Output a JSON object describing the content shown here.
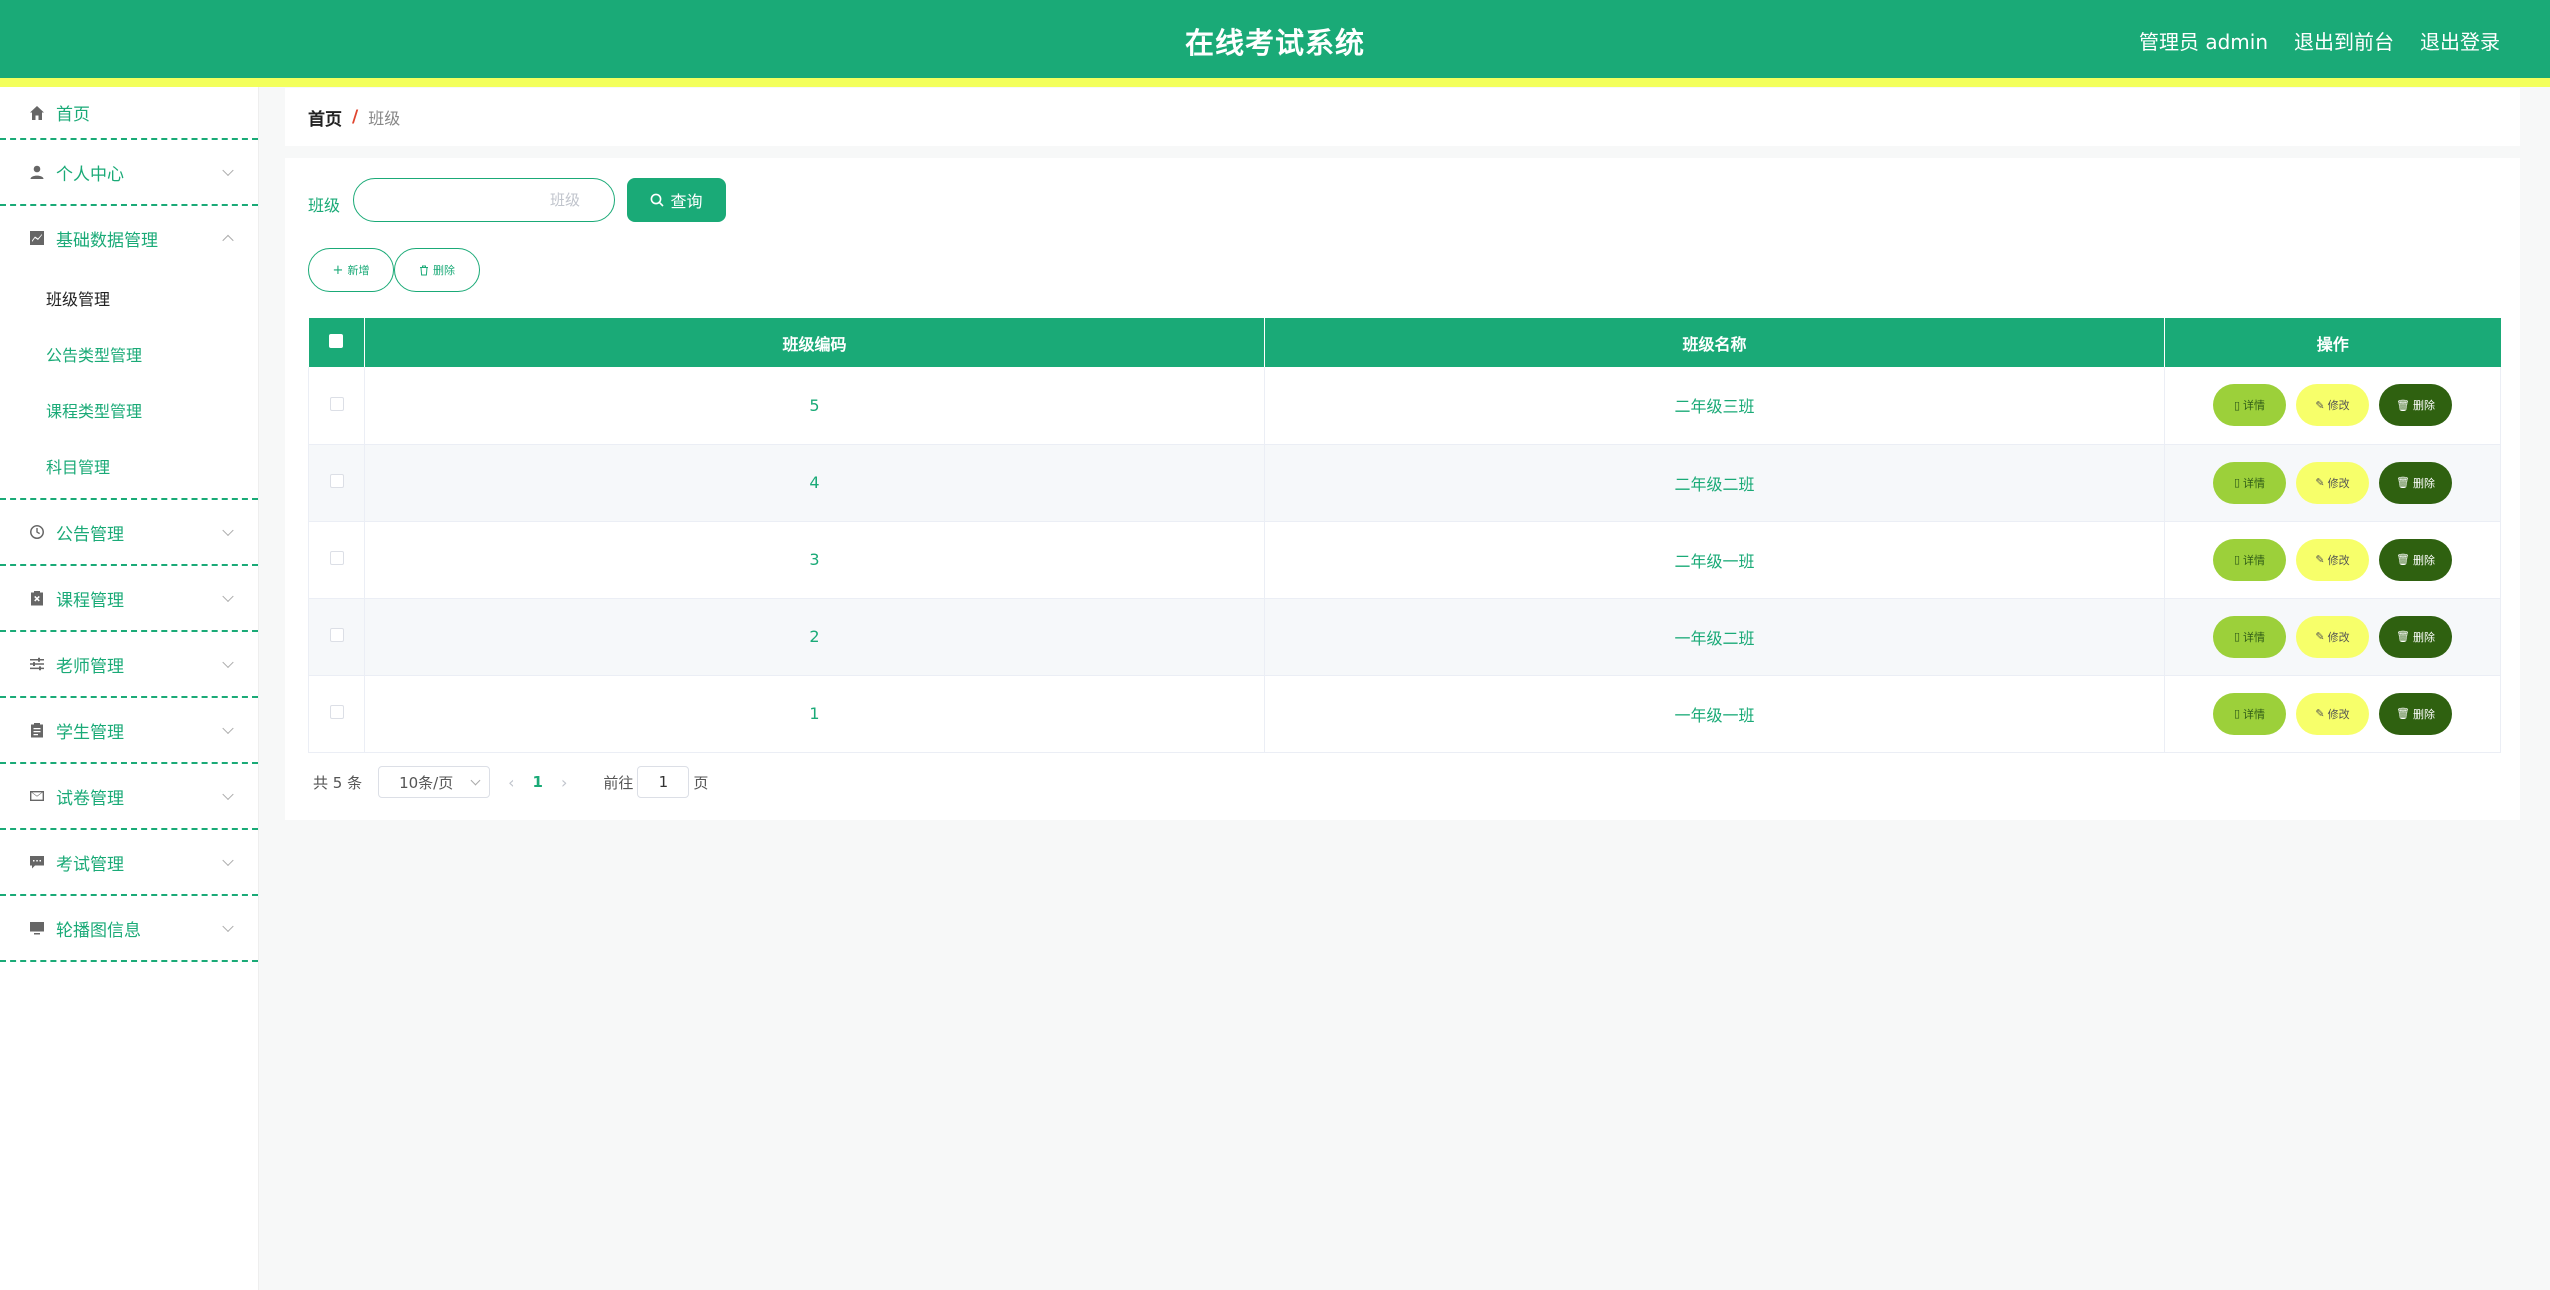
{
  "header": {
    "title": "在线考试系统",
    "admin_label": "管理员 admin",
    "front_link": "退出到前台",
    "logout_link": "退出登录"
  },
  "sidebar": {
    "home": "首页",
    "items": [
      {
        "label": "个人中心",
        "icon": "user-icon"
      },
      {
        "label": "基础数据管理",
        "icon": "chart-icon",
        "expanded": true,
        "children": [
          "班级管理",
          "公告类型管理",
          "课程类型管理",
          "科目管理"
        ],
        "active_child": "班级管理"
      },
      {
        "label": "公告管理",
        "icon": "clock-icon"
      },
      {
        "label": "课程管理",
        "icon": "clipboard-x-icon"
      },
      {
        "label": "老师管理",
        "icon": "sliders-icon"
      },
      {
        "label": "学生管理",
        "icon": "clipboard-icon"
      },
      {
        "label": "试卷管理",
        "icon": "mail-icon"
      },
      {
        "label": "考试管理",
        "icon": "chat-icon"
      },
      {
        "label": "轮播图信息",
        "icon": "monitor-icon"
      }
    ]
  },
  "breadcrumb": {
    "home": "首页",
    "separator": "/",
    "current": "班级"
  },
  "search": {
    "label": "班级",
    "placeholder": "班级",
    "value": "",
    "button": "查询"
  },
  "actions": {
    "add": "新增",
    "delete": "删除"
  },
  "table": {
    "columns": [
      "班级编码",
      "班级名称",
      "操作"
    ],
    "rows": [
      {
        "code": "5",
        "name": "二年级三班"
      },
      {
        "code": "4",
        "name": "二年级二班"
      },
      {
        "code": "3",
        "name": "二年级一班"
      },
      {
        "code": "2",
        "name": "一年级二班"
      },
      {
        "code": "1",
        "name": "一年级一班"
      }
    ],
    "row_actions": {
      "detail": "详情",
      "edit": "修改",
      "delete": "删除"
    }
  },
  "pagination": {
    "total_text": "共 5 条",
    "page_size": "10条/页",
    "current_page": "1",
    "goto_label": "前往",
    "goto_value": "1",
    "page_suffix": "页"
  },
  "colors": {
    "primary": "#1aaa77",
    "header_stripe": "#f3ff5c",
    "detail": "#9cd03a",
    "edit": "#f7ff6a",
    "delete": "#2f6110"
  }
}
